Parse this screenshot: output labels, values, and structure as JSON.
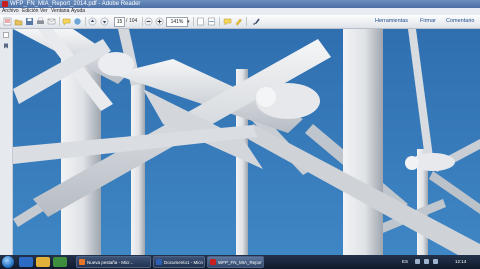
{
  "window": {
    "title": "WFP_FN_MIA_Report_2014.pdf - Adobe Reader"
  },
  "menu": [
    "Archivo",
    "Edición",
    "Ver",
    "Ventana",
    "Ayuda"
  ],
  "toolbar": {
    "current_page": "15",
    "page_separator": "/",
    "total_pages": "104",
    "zoom": "141%",
    "right_buttons": [
      "Herramientas",
      "Firmar",
      "Comentario"
    ]
  },
  "taskbar": {
    "tasks": [
      {
        "label": "Nueva pestaña - Micr...",
        "icon_color": "#e8742a"
      },
      {
        "label": "Documento1 - Micros...",
        "icon_color": "#2b5fb4"
      },
      {
        "label": "WFP_FN_MIA_Report...",
        "icon_color": "#c8201e"
      }
    ],
    "language": "ES",
    "time": "12:14"
  },
  "colors": {
    "sky_top": "#2f6fb0",
    "sky_bottom": "#3f86c4",
    "turbine": "#e4e6e9",
    "accent_link": "#1c4c8c"
  }
}
